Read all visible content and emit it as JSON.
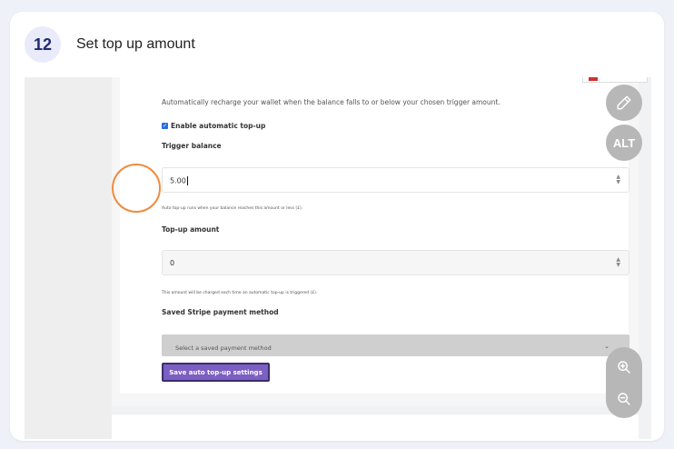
{
  "step": {
    "number": "12",
    "title": "Set top up amount"
  },
  "form": {
    "description": "Automatically recharge your wallet when the balance falls to or below your chosen trigger amount.",
    "enable_label": "Enable automatic top-up",
    "trigger_label": "Trigger balance",
    "trigger_value": "5.00",
    "trigger_hint": "Auto top-up runs when your balance reaches this amount or less (£).",
    "topup_label": "Top-up amount",
    "topup_value": "0",
    "topup_hint": "This amount will be charged each time an automatic top-up is triggered (£).",
    "payment_label": "Saved Stripe payment method",
    "payment_placeholder": "Select a saved payment method",
    "save_label": "Save auto top-up settings"
  },
  "tools": {
    "alt_label": "ALT"
  },
  "icons": [
    "pencil-icon",
    "zoom-in-icon",
    "zoom-out-icon",
    "chevron-down-icon",
    "checkbox-checked-icon",
    "spinner-arrows-icon"
  ],
  "colors": {
    "accent": "#7c5fc2",
    "focus_ring": "#f08a3c",
    "step_badge": "#1f2a6e",
    "checkbox": "#2d6cdf"
  }
}
